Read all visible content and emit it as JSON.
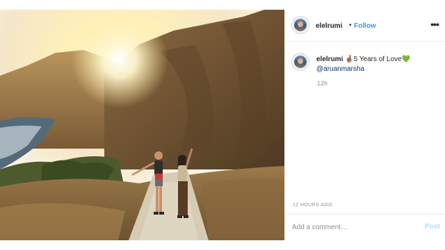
{
  "post": {
    "username": "elelrumi",
    "separator": "•",
    "follow_label": "Follow",
    "more_icon": "more-options-icon",
    "more_label": "•••",
    "caption": {
      "username": "elelrumi",
      "emoji_hand": "🤞🏽",
      "text": "5 Years of Love",
      "emoji_heart": "💚",
      "mention": "@aruanmarsha"
    },
    "age": "12h",
    "timestamp": "12 HOURS AGO"
  },
  "comment": {
    "placeholder": "Add a comment…",
    "post_label": "Post"
  },
  "colors": {
    "accent": "#3897f0",
    "post_disabled": "#b2dffc",
    "heart": "#2fbf3d"
  }
}
